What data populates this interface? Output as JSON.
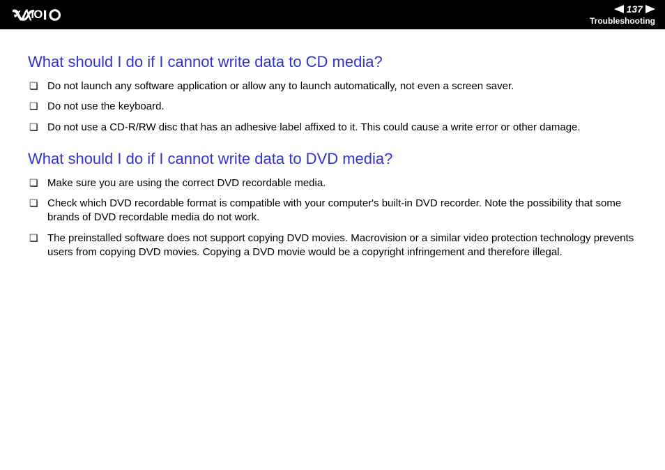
{
  "header": {
    "page_number": "137",
    "section": "Troubleshooting"
  },
  "sections": [
    {
      "heading": "What should I do if I cannot write data to CD media?",
      "items": [
        "Do not launch any software application or allow any to launch automatically, not even a screen saver.",
        "Do not use the keyboard.",
        "Do not use a CD-R/RW disc that has an adhesive label affixed to it. This could cause a write error or other damage."
      ]
    },
    {
      "heading": "What should I do if I cannot write data to DVD media?",
      "items": [
        "Make sure you are using the correct DVD recordable media.",
        "Check which DVD recordable format is compatible with your computer's built-in DVD recorder. Note the possibility that some brands of DVD recordable media do not work.",
        "The preinstalled software does not support copying DVD movies. Macrovision or a similar video protection technology prevents users from copying DVD movies. Copying a DVD movie would be a copyright infringement and therefore illegal."
      ]
    }
  ]
}
